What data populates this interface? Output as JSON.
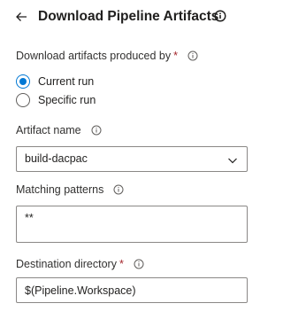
{
  "header": {
    "back_icon": "arrow-left-icon",
    "title": "Download Pipeline Artifacts",
    "info_icon": "info-circle-icon"
  },
  "download_source": {
    "label": "Download artifacts produced by",
    "required_marker": "*",
    "options": [
      {
        "label": "Current run",
        "selected": true
      },
      {
        "label": "Specific run",
        "selected": false
      }
    ]
  },
  "artifact_name": {
    "label": "Artifact name",
    "value": "build-dacpac",
    "dropdown_icon": "chevron-down-icon"
  },
  "matching_patterns": {
    "label": "Matching patterns",
    "value": "**"
  },
  "destination_directory": {
    "label": "Destination directory",
    "required_marker": "*",
    "value": "$(Pipeline.Workspace)"
  },
  "colors": {
    "accent": "#0078d4",
    "required": "#a4262c",
    "text": "#201f1e",
    "border": "#8a8886"
  }
}
